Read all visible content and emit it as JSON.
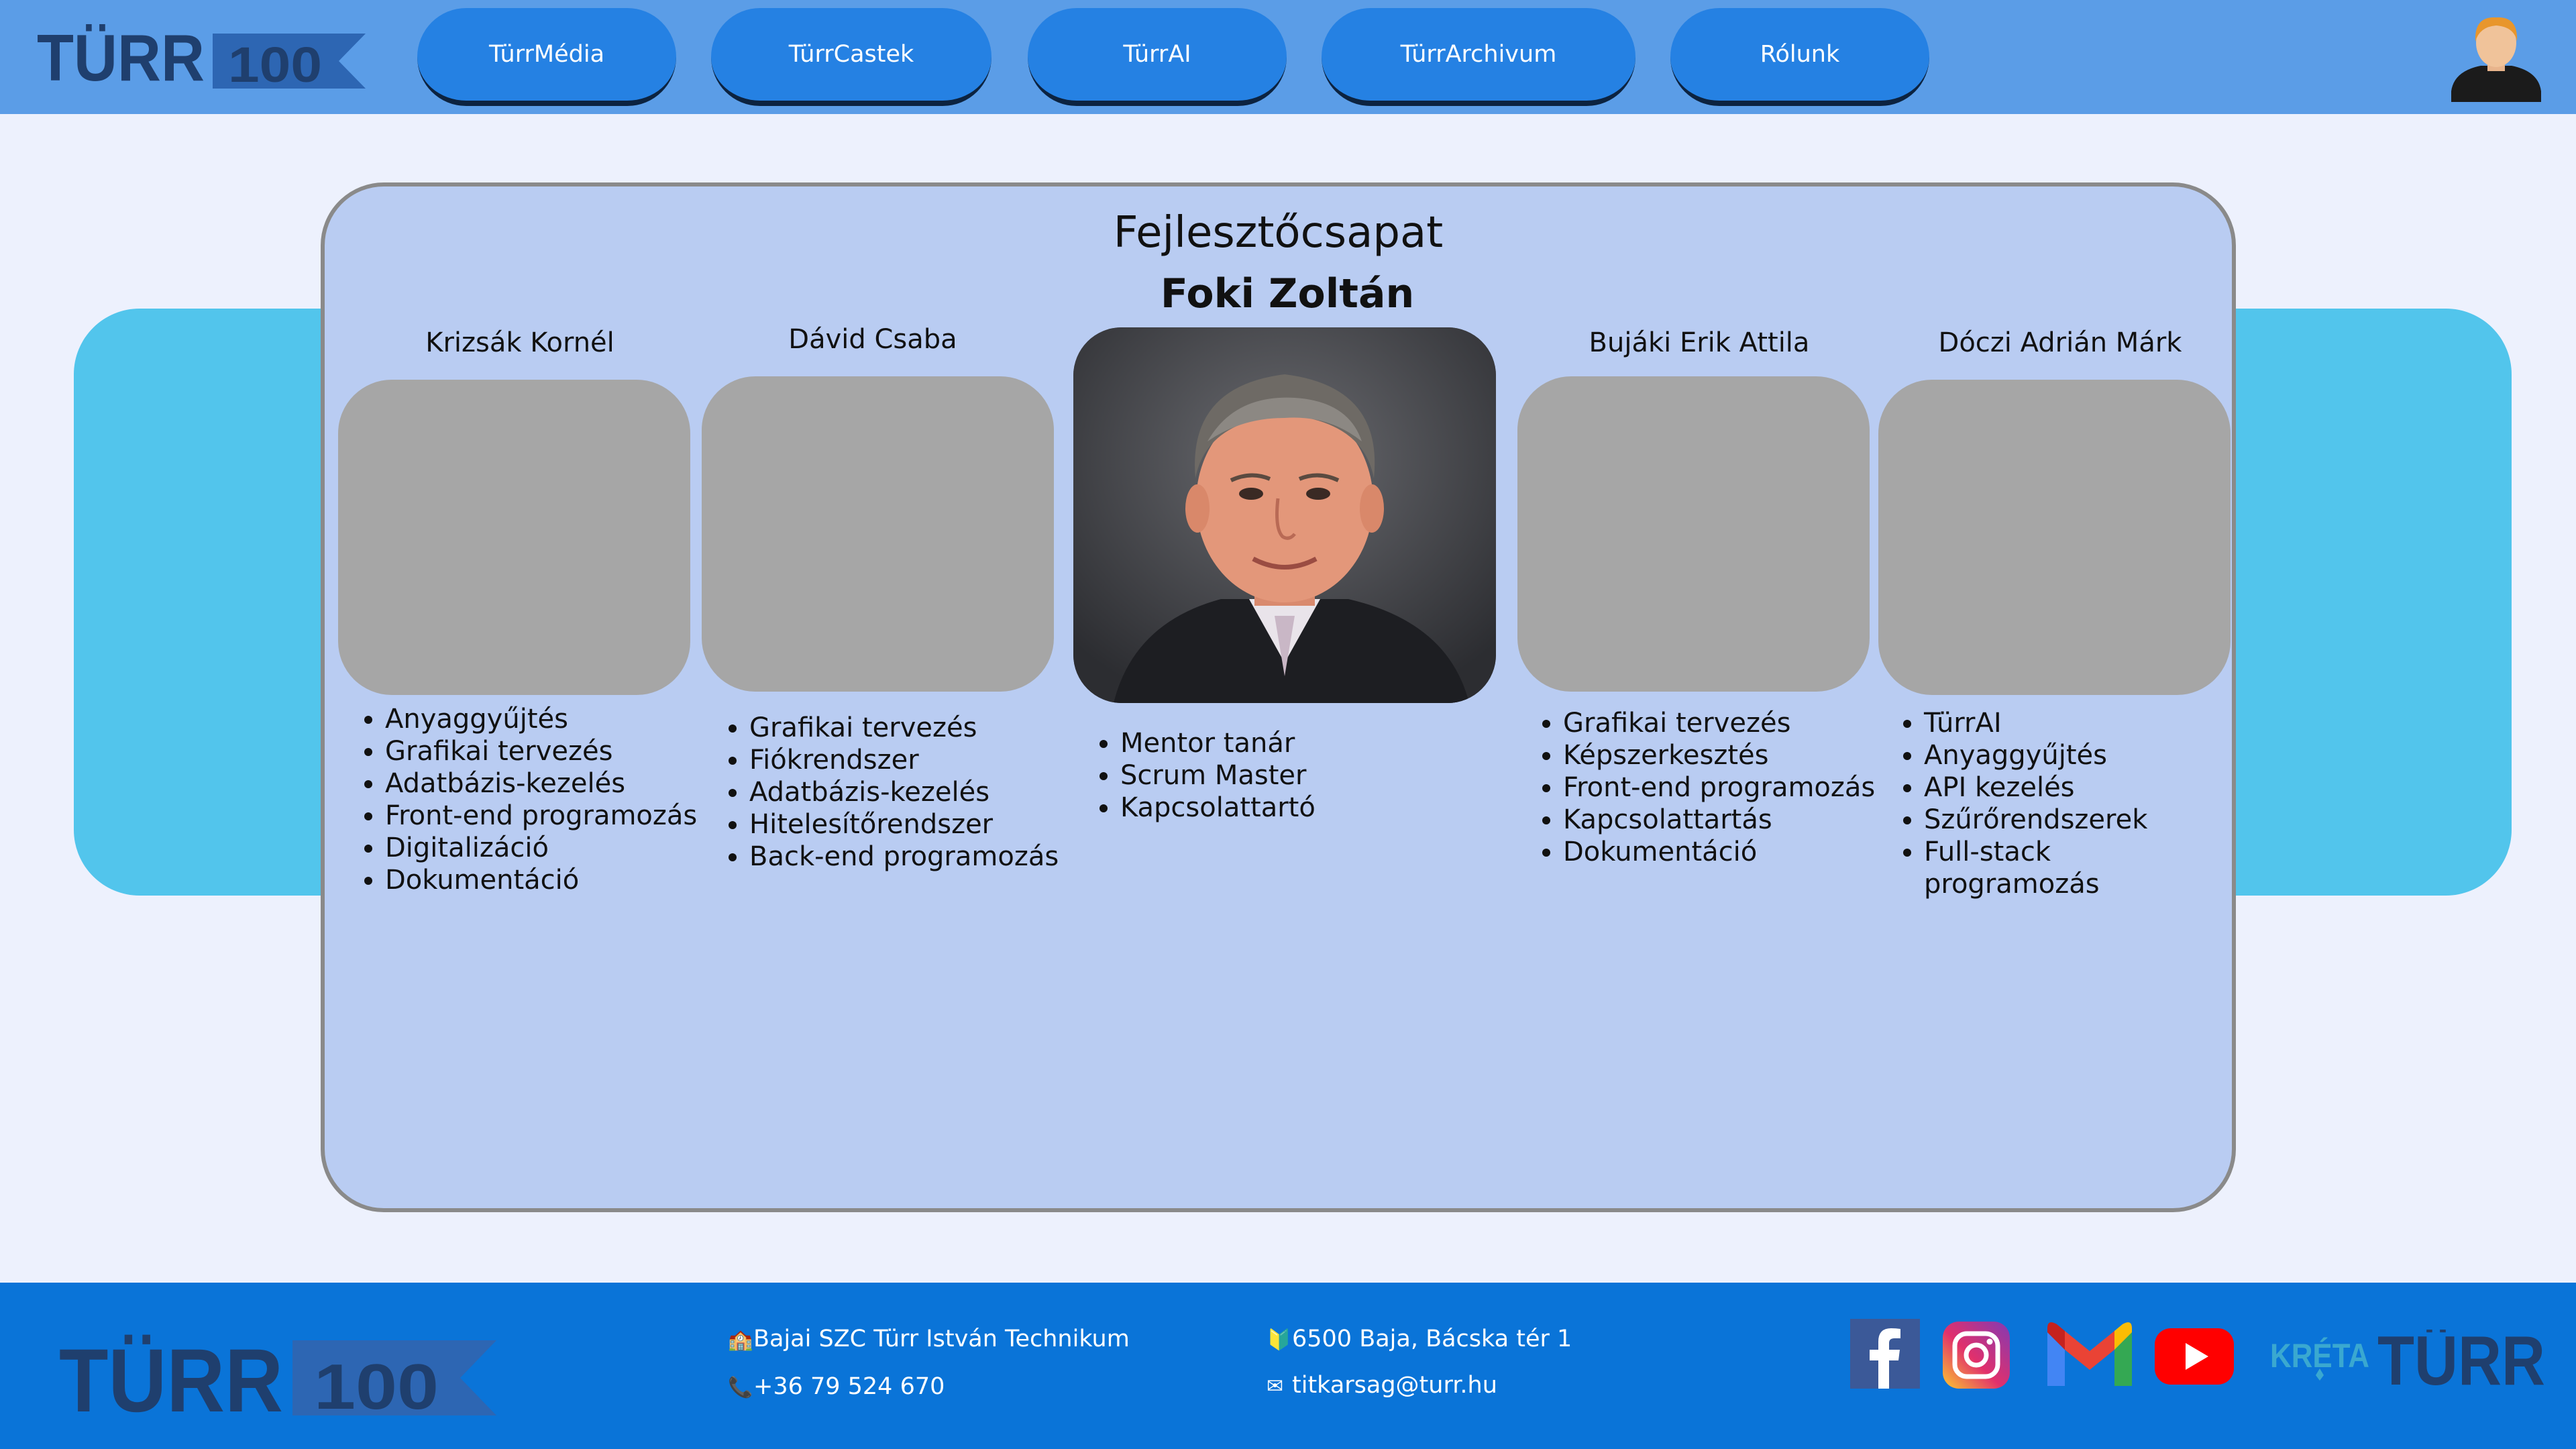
{
  "header": {
    "logo_text": "TÜRR",
    "logo_badge": "100",
    "nav": [
      {
        "label": "TürrMédia"
      },
      {
        "label": "TürrCastek"
      },
      {
        "label": "TürrAI"
      },
      {
        "label": "TürrArchivum"
      },
      {
        "label": "Rólunk"
      }
    ]
  },
  "team": {
    "title": "Fejlesztőcsapat",
    "mentor": {
      "name": "Foki Zoltán",
      "roles": [
        "Mentor tanár",
        "Scrum Master",
        "Kapcsolattartó"
      ]
    },
    "members": [
      {
        "name": "Krizsák Kornél",
        "roles": [
          "Anyaggyűjtés",
          "Grafikai tervezés",
          "Adatbázis-kezelés",
          "Front-end programozás",
          "Digitalizáció",
          "Dokumentáció"
        ]
      },
      {
        "name": "Dávid Csaba",
        "roles": [
          "Grafikai tervezés",
          "Fiókrendszer",
          "Adatbázis-kezelés",
          "Hitelesítőrendszer",
          "Back-end programozás"
        ]
      },
      {
        "name": "Bujáki Erik Attila",
        "roles": [
          "Grafikai tervezés",
          "Képszerkesztés",
          "Front-end programozás",
          "Kapcsolattartás",
          "Dokumentáció"
        ]
      },
      {
        "name": "Dóczi Adrián Márk",
        "roles": [
          "TürrAI",
          "Anyaggyűjtés",
          "API kezelés",
          "Szűrőrendszerek",
          "Full-stack programozás"
        ]
      }
    ]
  },
  "footer": {
    "logo_text": "TÜRR",
    "logo_badge": "100",
    "school": "Bajai SZC Türr István Technikum",
    "phone": "+36 79 524 670",
    "address": "6500 Baja, Bácska tér 1",
    "email": "titkarsag@turr.hu",
    "kreta_label": "KRÉTA",
    "turr_label": "TÜRR"
  },
  "colors": {
    "header_bg": "#5b9de7",
    "nav_button": "#2581e3",
    "page_bg": "#edf1fd",
    "band": "#52c5ec",
    "card_bg": "#b9ccf2",
    "footer_bg": "#0a74d8",
    "logo_dark": "#1f3f6e"
  },
  "icons": {
    "school": "school-building-icon",
    "phone": "phone-icon",
    "address": "map-pin-icon",
    "email": "envelope-icon",
    "social": [
      "facebook-icon",
      "instagram-icon",
      "gmail-icon",
      "youtube-icon"
    ]
  }
}
